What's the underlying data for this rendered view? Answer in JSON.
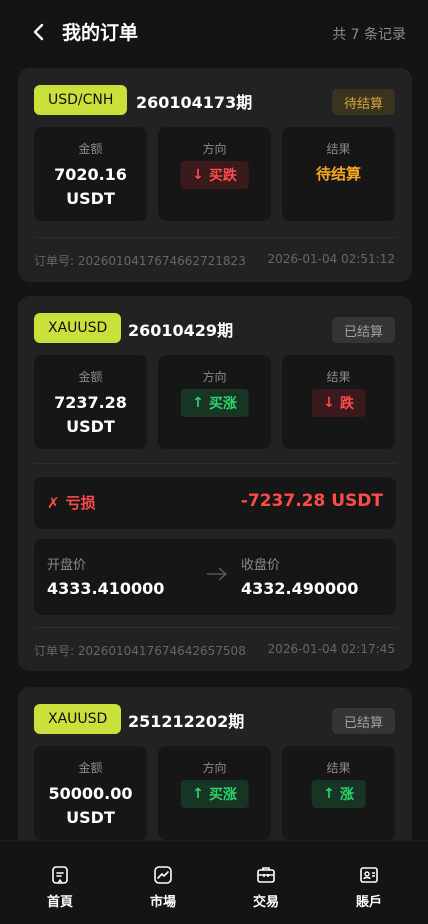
{
  "header": {
    "title": "我的订单",
    "count": "共 7 条记录"
  },
  "colors": {
    "accent": "#c9e13a",
    "down": "#ff4b4b",
    "up": "#2ed36b",
    "pending": "#f5a623"
  },
  "labels": {
    "amount": "金额",
    "direction": "方向",
    "result": "结果",
    "open_price": "开盘价",
    "close_price": "收盘价"
  },
  "orders": [
    {
      "pair": "USD/CNH",
      "period": "260104173期",
      "status": "待结算",
      "amount_value": "7020.16",
      "amount_unit": "USDT",
      "direction": "买跌",
      "direction_arrow": "↓",
      "result": "待结算",
      "order_no": "订单号: 2026010417674662721823",
      "time": "2026-01-04 02:51:12"
    },
    {
      "pair": "XAUUSD",
      "period": "26010429期",
      "status": "已结算",
      "amount_value": "7237.28",
      "amount_unit": "USDT",
      "direction": "买涨",
      "direction_arrow": "↑",
      "result": "跌",
      "result_arrow": "↓",
      "pnl_label": "亏损",
      "pnl_icon": "✗",
      "pnl_value": "-7237.28 USDT",
      "open_price": "4333.410000",
      "close_price": "4332.490000",
      "order_no": "订单号: 2026010417674642657508",
      "time": "2026-01-04 02:17:45"
    },
    {
      "pair": "XAUUSD",
      "period": "251212202期",
      "status": "已结算",
      "amount_value": "50000.00",
      "amount_unit": "USDT",
      "direction": "买涨",
      "direction_arrow": "↑",
      "result": "涨",
      "result_arrow": "↑"
    }
  ],
  "tabbar": [
    {
      "label": "首頁",
      "icon": "home-icon"
    },
    {
      "label": "市場",
      "icon": "market-icon"
    },
    {
      "label": "交易",
      "icon": "trade-icon"
    },
    {
      "label": "賬戶",
      "icon": "account-icon"
    }
  ]
}
